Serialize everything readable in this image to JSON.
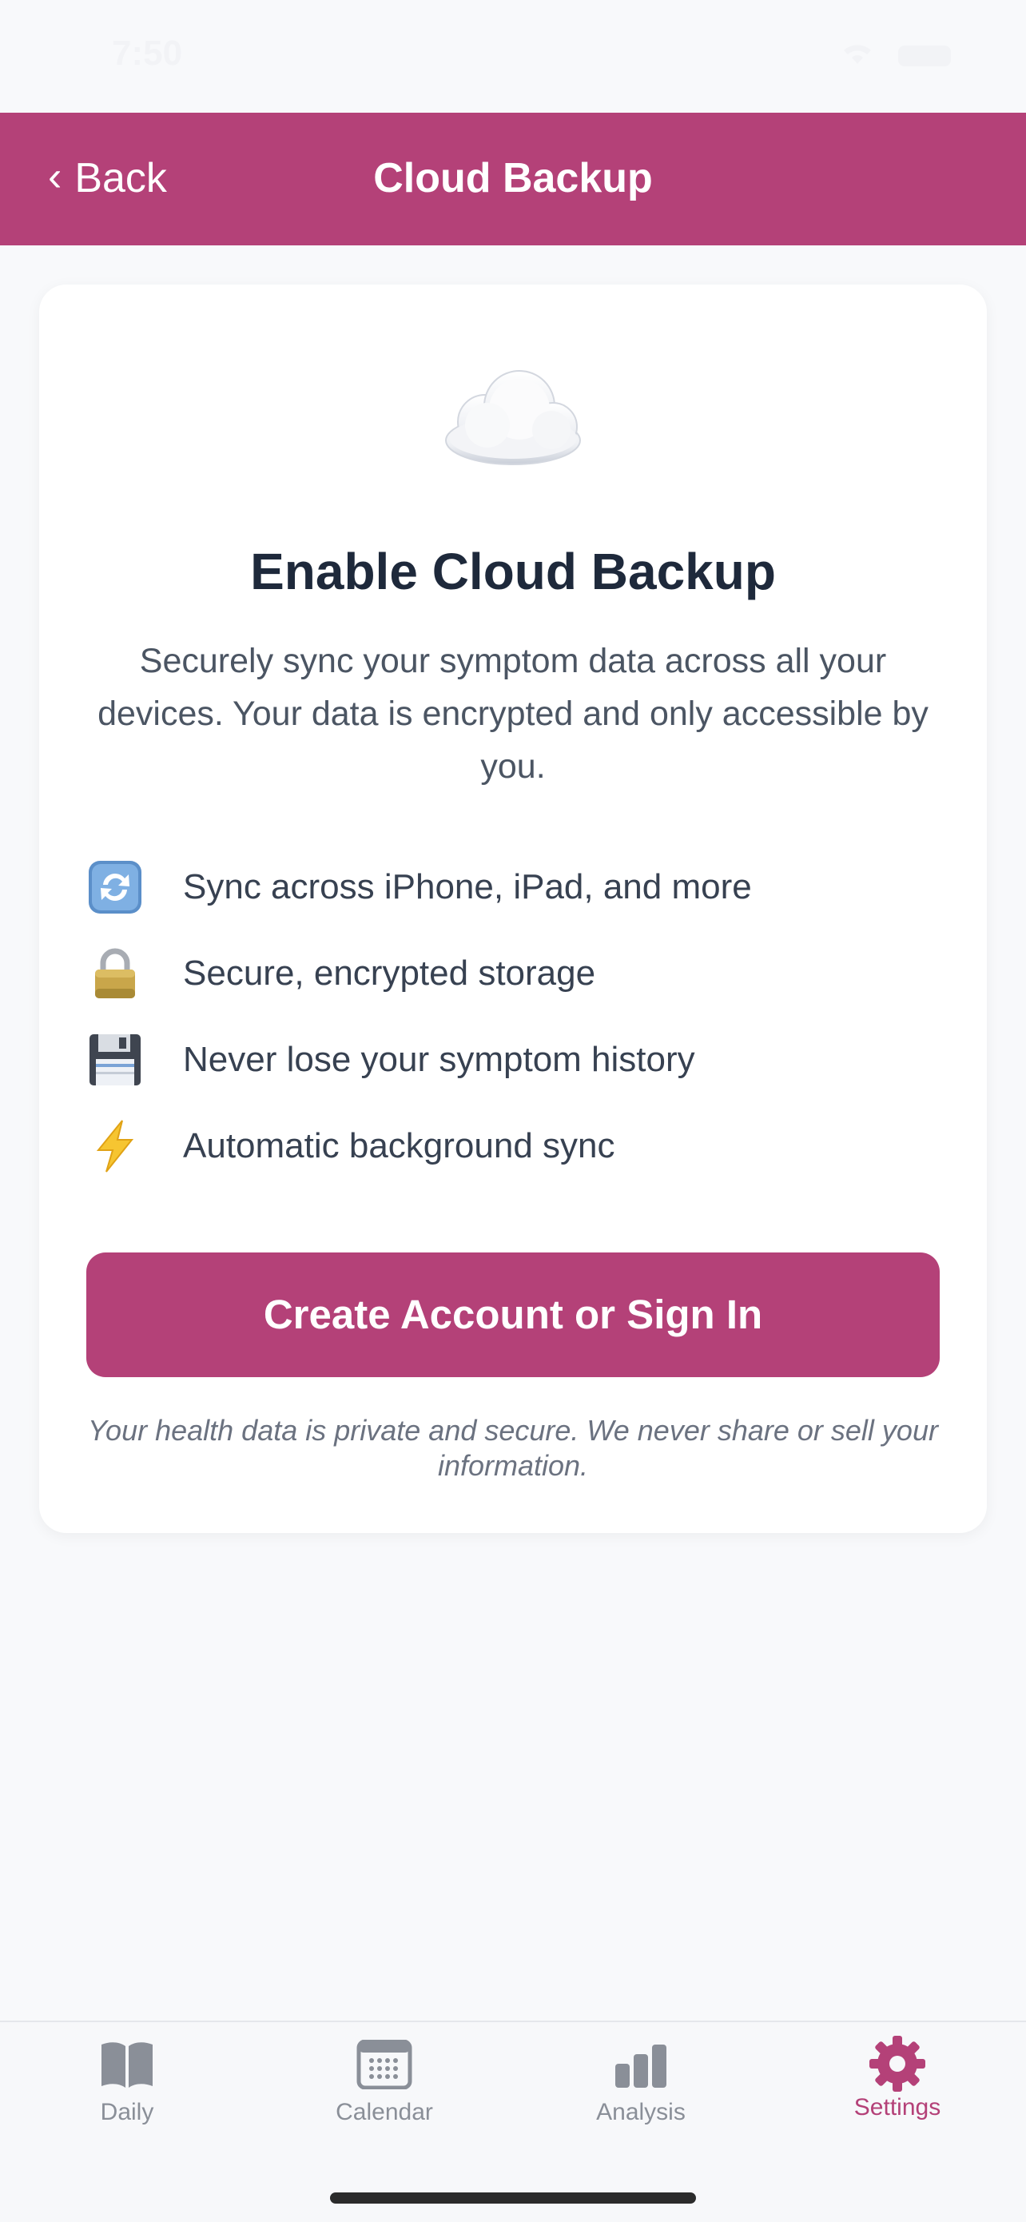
{
  "status_bar": {
    "time": "7:50"
  },
  "navbar": {
    "back_label": "Back",
    "back_chevron": "‹",
    "title": "Cloud Backup"
  },
  "card": {
    "title": "Enable Cloud Backup",
    "description": "Securely sync your symptom data across all your devices. Your data is encrypted and only accessible by you.",
    "features": [
      {
        "icon": "sync-icon",
        "text": "Sync across iPhone, iPad, and more"
      },
      {
        "icon": "lock-icon",
        "text": "Secure, encrypted storage"
      },
      {
        "icon": "floppy-disk-icon",
        "text": "Never lose your symptom history"
      },
      {
        "icon": "lightning-icon",
        "text": "Automatic background sync"
      }
    ],
    "cta_label": "Create Account or Sign In",
    "privacy_note": "Your health data is private and secure. We never share or sell your information."
  },
  "tabbar": {
    "tabs": [
      {
        "label": "Daily",
        "icon": "book-icon",
        "active": false
      },
      {
        "label": "Calendar",
        "icon": "calendar-icon",
        "active": false
      },
      {
        "label": "Analysis",
        "icon": "bar-chart-icon",
        "active": false
      },
      {
        "label": "Settings",
        "icon": "gear-icon",
        "active": true
      }
    ]
  },
  "colors": {
    "accent": "#b44178",
    "background": "#f8f9fb",
    "card": "#ffffff",
    "tab_inactive": "#8a8f98"
  }
}
